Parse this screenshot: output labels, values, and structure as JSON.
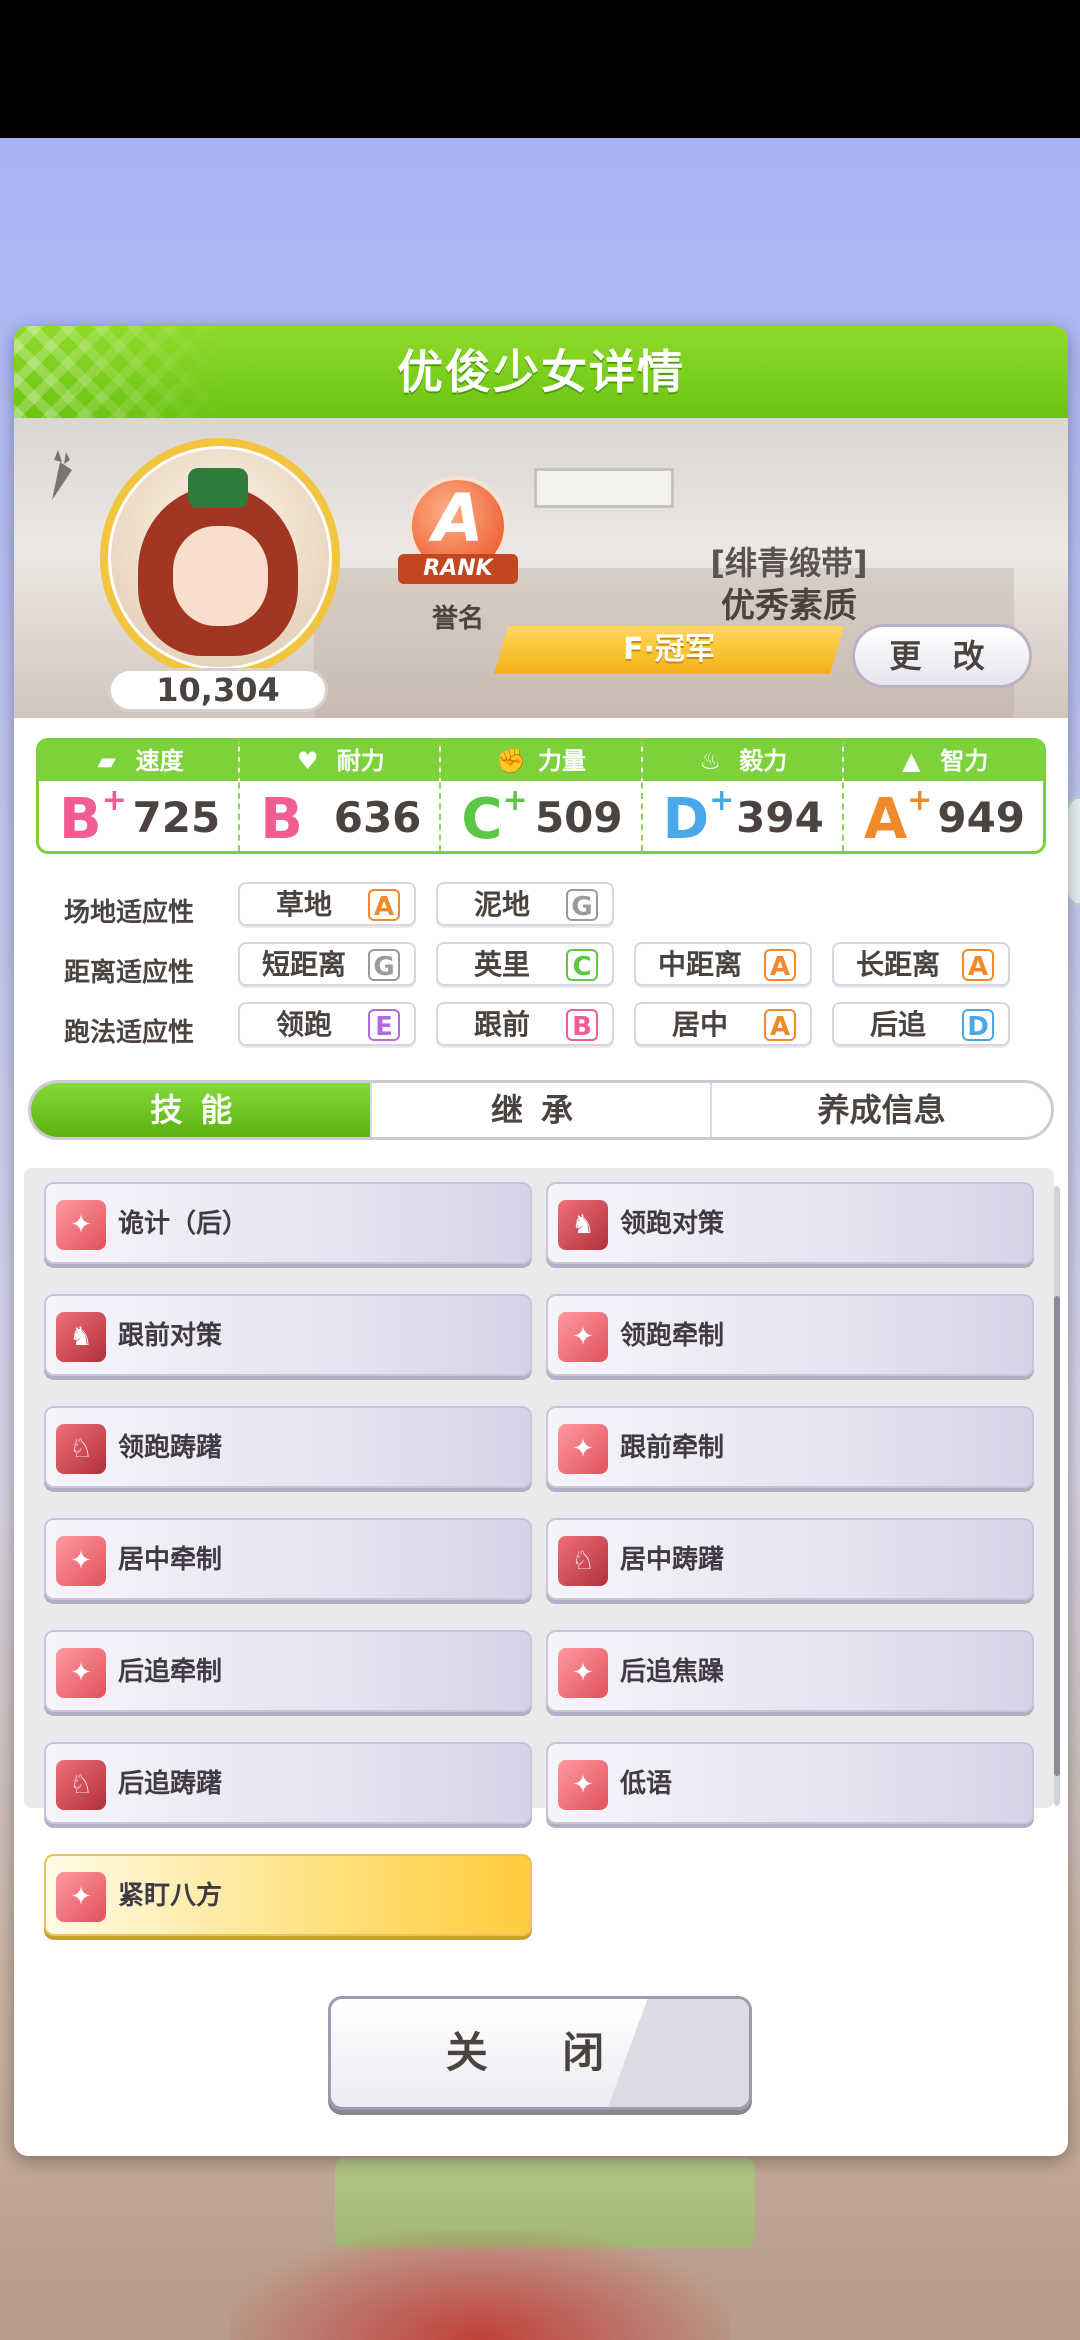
{
  "dialog": {
    "title": "优俊少女详情"
  },
  "profile": {
    "score": "10,304",
    "rank_letter": "A",
    "rank_word": "RANK",
    "fame_label": "誉名",
    "epithet_line1": "[绯青缎带]",
    "epithet_line2": "优秀素质",
    "champion_label": "F·冠军",
    "change_label": "更 改"
  },
  "stats": [
    {
      "name": "速度",
      "icon": "shoe-icon",
      "grade": "B",
      "plus": "+",
      "value": "725",
      "color": "#f25c95"
    },
    {
      "name": "耐力",
      "icon": "heart-icon",
      "grade": "B",
      "plus": "",
      "value": "636",
      "color": "#f25c95"
    },
    {
      "name": "力量",
      "icon": "arm-icon",
      "grade": "C",
      "plus": "+",
      "value": "509",
      "color": "#5cc742"
    },
    {
      "name": "毅力",
      "icon": "flame-icon",
      "grade": "D",
      "plus": "+",
      "value": "394",
      "color": "#4aa8ea"
    },
    {
      "name": "智力",
      "icon": "graduation-cap-icon",
      "grade": "A",
      "plus": "+",
      "value": "949",
      "color": "#f28a2c"
    }
  ],
  "aptitude": {
    "track_label": "场地适应性",
    "distance_label": "距离适应性",
    "style_label": "跑法适应性",
    "track": [
      {
        "name": "草地",
        "grade": "A"
      },
      {
        "name": "泥地",
        "grade": "G"
      }
    ],
    "distance": [
      {
        "name": "短距离",
        "grade": "G"
      },
      {
        "name": "英里",
        "grade": "C"
      },
      {
        "name": "中距离",
        "grade": "A"
      },
      {
        "name": "长距离",
        "grade": "A"
      }
    ],
    "style": [
      {
        "name": "领跑",
        "grade": "E"
      },
      {
        "name": "跟前",
        "grade": "B"
      },
      {
        "name": "居中",
        "grade": "A"
      },
      {
        "name": "后追",
        "grade": "D"
      }
    ]
  },
  "grade_colors": {
    "A": "#f28a2c",
    "B": "#f25c95",
    "C": "#5cc742",
    "D": "#4aa8ea",
    "E": "#b46adf",
    "G": "#9a9a9a"
  },
  "tabs": [
    {
      "label": "技能"
    },
    {
      "label": "继承"
    },
    {
      "label": "养成信息"
    }
  ],
  "skills": [
    {
      "name": "诡计（后）",
      "icon": "sparkle-icon"
    },
    {
      "name": "领跑对策",
      "icon": "horse-head-icon"
    },
    {
      "name": "跟前对策",
      "icon": "horse-head-icon"
    },
    {
      "name": "领跑牵制",
      "icon": "sparkle-icon"
    },
    {
      "name": "领跑踌躇",
      "icon": "horse-sit-icon"
    },
    {
      "name": "跟前牵制",
      "icon": "sparkle-icon"
    },
    {
      "name": "居中牵制",
      "icon": "sparkle-icon"
    },
    {
      "name": "居中踌躇",
      "icon": "horse-sit-icon"
    },
    {
      "name": "后追牵制",
      "icon": "sparkle-icon"
    },
    {
      "name": "后追焦躁",
      "icon": "sparkle-icon"
    },
    {
      "name": "后追踌躇",
      "icon": "horse-sit-icon"
    },
    {
      "name": "低语",
      "icon": "sparkle-icon"
    },
    {
      "name": "紧盯八方",
      "icon": "sparkle-icon"
    }
  ],
  "close_label": "关 闭"
}
